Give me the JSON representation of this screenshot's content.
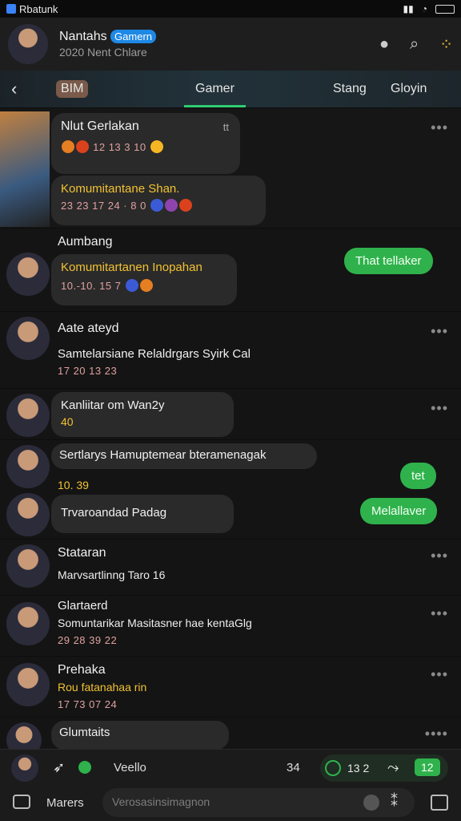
{
  "status_bar": {
    "carrier": "Rbatunk",
    "icons": [
      "signal",
      "wifi",
      "battery"
    ]
  },
  "header": {
    "title": "Nantahs",
    "tag": "Gamern",
    "subtitle": "2020 Nent Chlare"
  },
  "tabs": {
    "left": "BIM",
    "active": "Gamer",
    "right1": "Stang",
    "right2": "Gloyin"
  },
  "messages": [
    {
      "name": "Nlut Gerlakan",
      "badge": "tt",
      "line": "12 13 3 10"
    },
    {
      "line1": "Komumitantane Shan.",
      "line2": "23 23 17 24 · 8 0"
    },
    {
      "name": "Aumbang",
      "line1": "Komumitartanen Inopahan",
      "line2": "10.-10. 15 7"
    },
    {
      "name": "Aate ateyd",
      "line1": "Samtelarsiane Relaldrgars Syirk Cal",
      "line2": "17 20 13 23"
    },
    {
      "name": "Kanliitar om Wan2y",
      "line1": "40"
    },
    {
      "name": "Sertlarys Hamuptemear bteramenagak",
      "line1": "10. 39"
    },
    {
      "name": "Trvaroandad Padag"
    },
    {
      "name": "Stataran",
      "line1": "Marvsartlinng Taro 16"
    },
    {
      "name": "Glartaerd",
      "line1": "Somuntarikar Masitasner hae kentaGlg",
      "line2": "29 28 39 22"
    },
    {
      "name": "Prehaka",
      "line1": "Rou fatanahaa rin",
      "line2": "17 73 07 24"
    },
    {
      "name": "Glumtaits"
    }
  ],
  "sent": [
    "That tellaker",
    "tet",
    "Melallaver"
  ],
  "composer": {
    "label": "Veello",
    "count1": "34",
    "count2": "13 2",
    "badge": "12",
    "left_label": "Marers",
    "placeholder": "Verosasinsimagnon"
  }
}
